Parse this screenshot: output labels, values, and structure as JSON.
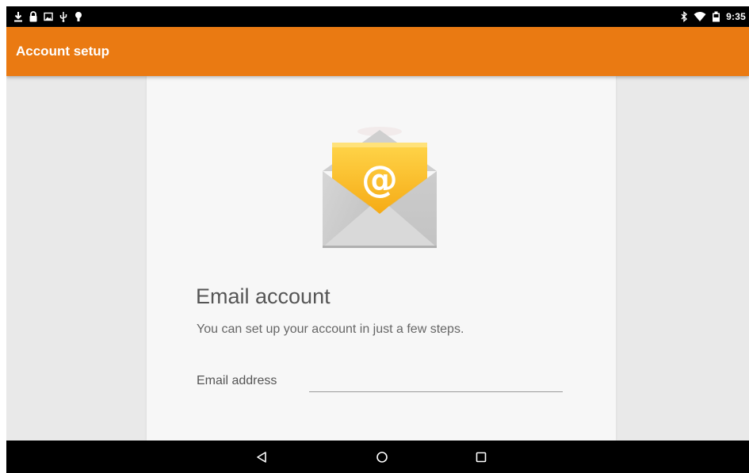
{
  "status_bar": {
    "time": "9:35",
    "left_icons": [
      "download-icon",
      "lock-icon",
      "image-icon",
      "usb-icon",
      "android-debug-icon"
    ],
    "right_icons": [
      "bluetooth-icon",
      "wifi-icon",
      "battery-icon"
    ]
  },
  "action_bar": {
    "title": "Account setup",
    "color": "#ea7a12"
  },
  "setup": {
    "illustration": "email-envelope-icon",
    "heading": "Email account",
    "subtext": "You can set up your account in just a few steps.",
    "email_label": "Email address",
    "email_value": ""
  },
  "nav_bar": {
    "buttons": [
      "back-icon",
      "home-icon",
      "recents-icon"
    ]
  }
}
